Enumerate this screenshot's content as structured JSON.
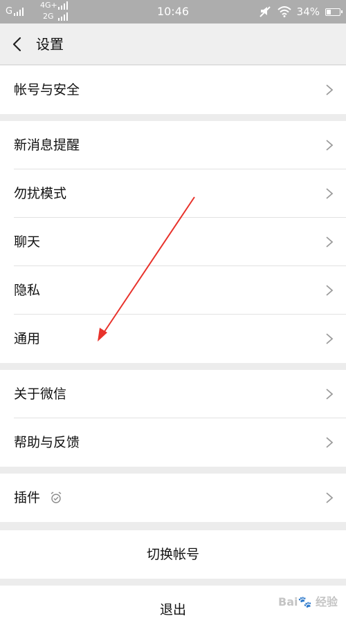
{
  "status_bar": {
    "carrier_1": "G",
    "carrier_2": "4G+",
    "carrier_3": "2G",
    "time": "10:46",
    "battery_percent": "34%",
    "battery_level": 0.34,
    "icons": [
      "signal-icon",
      "mute-icon",
      "wifi-icon",
      "battery-icon"
    ]
  },
  "nav": {
    "back_icon": "chevron-left-icon",
    "title": "设置"
  },
  "settings_items": [
    {
      "label": "帐号与安全",
      "icon": "chevron-right-icon"
    },
    {
      "label": "新消息提醒",
      "icon": "chevron-right-icon"
    },
    {
      "label": "勿扰模式",
      "icon": "chevron-right-icon"
    },
    {
      "label": "聊天",
      "icon": "chevron-right-icon"
    },
    {
      "label": "隐私",
      "icon": "chevron-right-icon"
    },
    {
      "label": "通用",
      "icon": "chevron-right-icon"
    },
    {
      "label": "关于微信",
      "icon": "chevron-right-icon"
    },
    {
      "label": "帮助与反馈",
      "icon": "chevron-right-icon"
    },
    {
      "label": "插件",
      "icon": "chevron-right-icon",
      "badge_icon": "plugin-badge-icon"
    }
  ],
  "actions": {
    "switch_account": "切换帐号",
    "logout": "退出"
  },
  "annotation": {
    "arrow_color": "#e8322b"
  },
  "watermark": {
    "text": "Bai🐾 经验"
  },
  "colors": {
    "status_bar_bg": "#adadad",
    "page_bg": "#ececec",
    "row_bg": "#ffffff",
    "divider": "#e2e2e2"
  }
}
